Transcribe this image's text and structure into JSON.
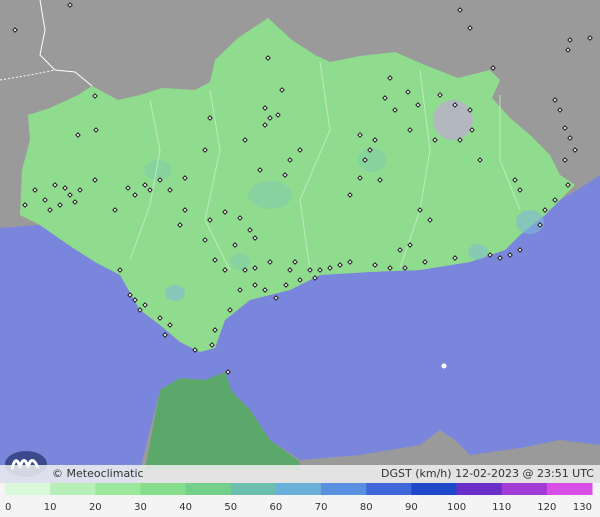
{
  "map": {
    "land_color": "#9a9a9a",
    "sea_color": "#7a86dc",
    "region_color": "#8fdc8f",
    "africa_color": "#5aa86a"
  },
  "branding": {
    "copyright": "© Meteoclimatic",
    "logo_icon": "meteoclimatic-logo-icon"
  },
  "product": {
    "variable": "DGST (km/h)",
    "timestamp": "12-02-2023 @ 23:51 UTC",
    "full_label": "DGST (km/h)   12-02-2023 @ 23:51 UTC"
  },
  "legend": {
    "ticks": [
      "0",
      "10",
      "20",
      "30",
      "40",
      "50",
      "60",
      "70",
      "80",
      "90",
      "100",
      "110",
      "120",
      "130"
    ],
    "colors": [
      "#d9f7d9",
      "#b8efb8",
      "#9be79b",
      "#86dd8c",
      "#74cf8a",
      "#6cbfae",
      "#6ab0d8",
      "#5a90e0",
      "#3f67d8",
      "#1f49c8",
      "#6a2fc8",
      "#a13bd6",
      "#d84fe6",
      "#f2a9f2"
    ]
  }
}
